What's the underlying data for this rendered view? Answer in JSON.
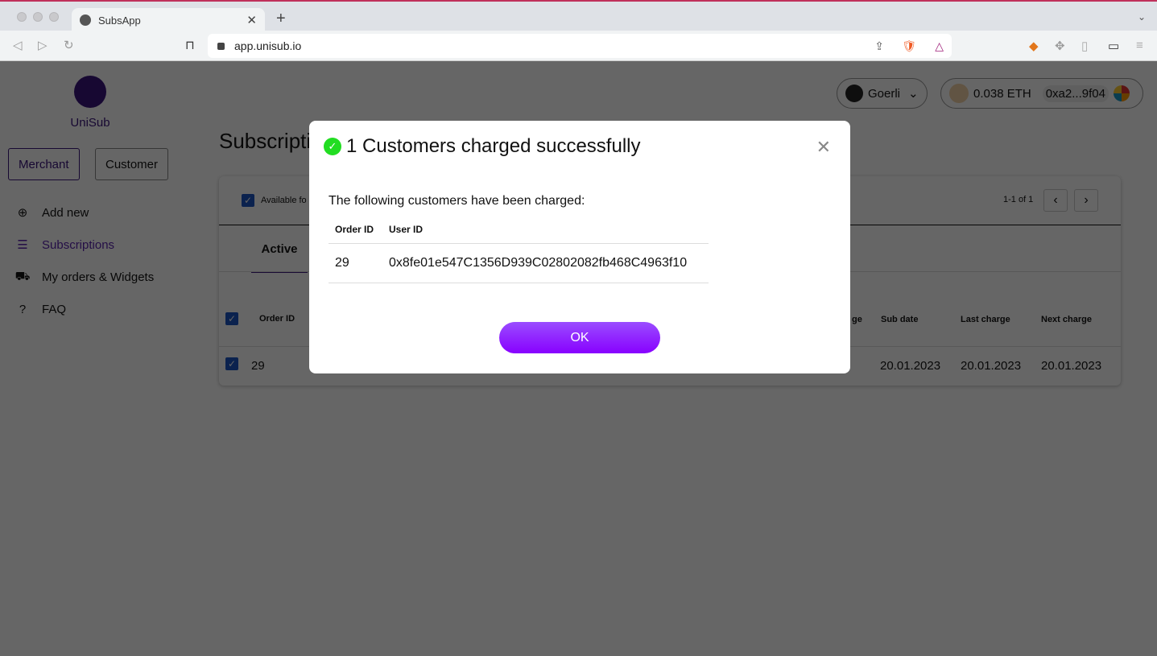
{
  "browser": {
    "tab_title": "SubsApp",
    "url": "app.unisub.io"
  },
  "app": {
    "logo_text": "UniSub",
    "roles": [
      "Merchant",
      "Customer"
    ],
    "sidebar": [
      {
        "label": "Add new",
        "icon": "plus-circle-icon"
      },
      {
        "label": "Subscriptions",
        "icon": "database-icon"
      },
      {
        "label": "My orders & Widgets",
        "icon": "cart-icon"
      },
      {
        "label": "FAQ",
        "icon": "question-circle-icon"
      }
    ],
    "page_title": "Subscriptions",
    "network": "Goerli",
    "balance": "0.038 ETH",
    "address": "0xa2...9f04",
    "filter_label": "Available fo",
    "pagination": "1-1 of 1",
    "tab_active": "Active",
    "columns": {
      "order_id": "Order ID",
      "last_col_partial": "ge",
      "sub_date": "Sub date",
      "last_charge": "Last charge",
      "next_charge": "Next charge"
    },
    "row": {
      "order_id": "29",
      "sub_date": "20.01.2023",
      "last_charge": "20.01.2023",
      "next_charge": "20.01.2023"
    }
  },
  "modal": {
    "title": "1 Customers charged successfully",
    "intro": "The following customers have been charged:",
    "headers": [
      "Order ID",
      "User ID"
    ],
    "rows": [
      {
        "order_id": "29",
        "user_id": "0x8fe01e547C1356D939C02802082fb468C4963f10"
      }
    ],
    "ok_label": "OK"
  },
  "colors": {
    "brand": "#3a1478",
    "ok_button": "#8800ff",
    "success": "#22dd22"
  }
}
